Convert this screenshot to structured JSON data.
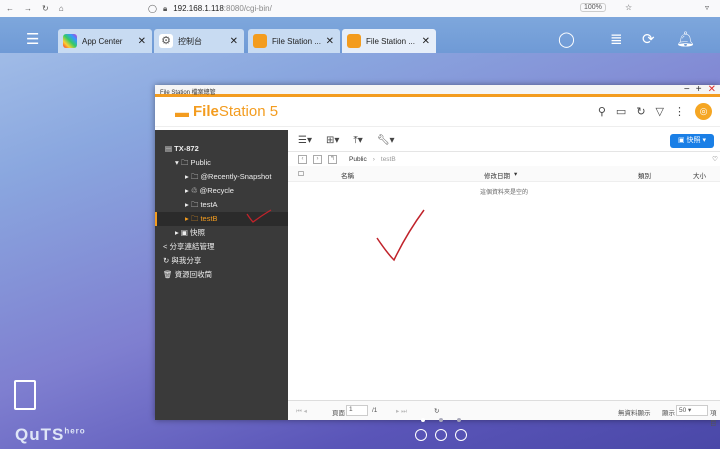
{
  "browser": {
    "url_host": "192.168.1.118",
    "url_rest": ":8080/cgi-bin/",
    "zoom": "100%"
  },
  "tabs": [
    {
      "label": "App Center"
    },
    {
      "label": "控制台"
    },
    {
      "label": "File Station ..."
    },
    {
      "label": "File Station ..."
    }
  ],
  "window": {
    "title": "File Station 檔案總管",
    "logo_bold": "File",
    "logo_rest": "Station 5"
  },
  "sidebar": {
    "items": [
      {
        "label": "TX-872"
      },
      {
        "label": "Public"
      },
      {
        "label": "@Recently-Snapshot"
      },
      {
        "label": "@Recycle"
      },
      {
        "label": "testA"
      },
      {
        "label": "testB"
      },
      {
        "label": "快照"
      },
      {
        "label": "分享連結管理"
      },
      {
        "label": "與我分享"
      },
      {
        "label": "資源回收筒"
      }
    ]
  },
  "toolbar": {
    "snapshot_label": "快照"
  },
  "breadcrumb": {
    "parent": "Public",
    "current": "testB"
  },
  "table": {
    "columns": [
      "名稱",
      "修改日期",
      "類別",
      "大小"
    ],
    "empty_text": "這個資料夾是空的"
  },
  "footer": {
    "page_label": "頁面",
    "page_value": "1",
    "page_total": "/1",
    "no_data": "無資料顯示",
    "show_label": "顯示",
    "per_page": "50",
    "items_label": "項目"
  },
  "desktop": {
    "brand": "QuTS",
    "brand_sup": "hero"
  }
}
